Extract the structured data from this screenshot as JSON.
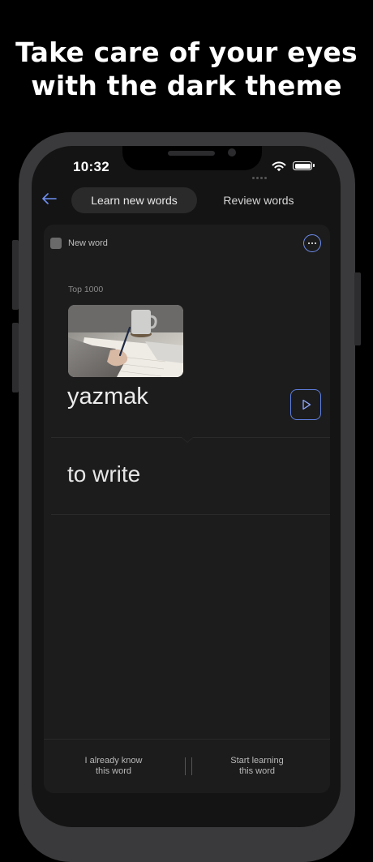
{
  "headline": {
    "line1": "Take care of your eyes",
    "line2": "with the dark theme"
  },
  "status_bar": {
    "time": "10:32"
  },
  "nav": {
    "back_icon": "arrow-left-icon",
    "tabs": [
      {
        "label": "Learn new words",
        "active": true
      },
      {
        "label": "Review words",
        "active": false
      }
    ]
  },
  "card": {
    "status_label": "New word",
    "more_icon": "ellipsis-icon",
    "category": "Top 1000",
    "word": "yazmak",
    "play_icon": "play-icon",
    "translation": "to write",
    "image_subject": "hand writing in notebook with coffee cup"
  },
  "footer": {
    "know_label_1": "I already know",
    "know_label_2": "this word",
    "start_label_1": "Start learning",
    "start_label_2": "this word"
  },
  "colors": {
    "background": "#000000",
    "screen": "#141414",
    "card": "#1c1c1c",
    "accent": "#6f8ef0"
  }
}
